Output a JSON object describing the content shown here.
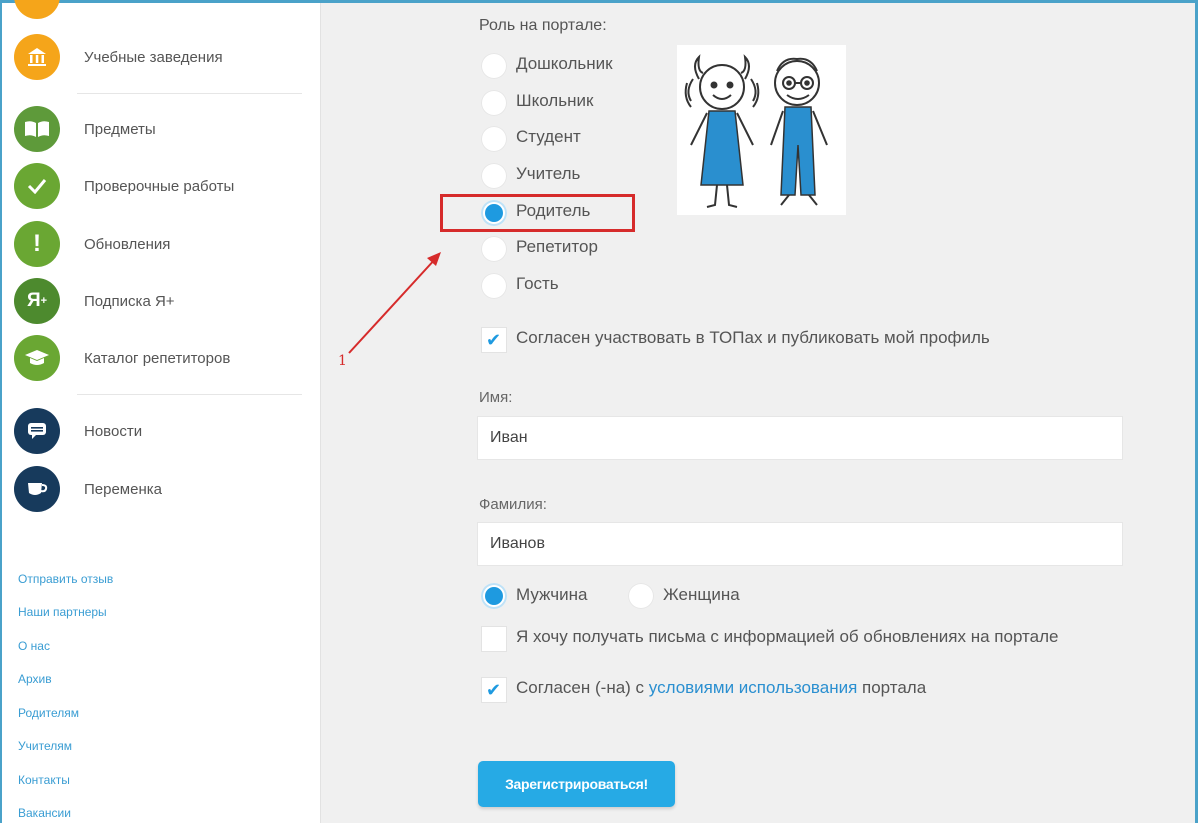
{
  "sidebar": {
    "items": [
      {
        "label": "Учебные заведения",
        "icon": "building-icon",
        "color": "#f5a51a",
        "glyph": "🏛"
      },
      {
        "label": "Предметы",
        "icon": "book-icon",
        "color": "#5e9a3a",
        "glyph": "▮▮"
      },
      {
        "label": "Проверочные работы",
        "icon": "checkmark-icon",
        "color": "#6aa733",
        "glyph": "✓"
      },
      {
        "label": "Обновления",
        "icon": "exclamation-icon",
        "color": "#6aa733",
        "glyph": "!"
      },
      {
        "label": "Подписка Я+",
        "icon": "ya-plus-icon",
        "color": "#4d8a2e",
        "glyph": "Я"
      },
      {
        "label": "Каталог репетиторов",
        "icon": "graduation-cap-icon",
        "color": "#6aa733",
        "glyph": "🎓"
      },
      {
        "label": "Новости",
        "icon": "message-icon",
        "color": "#173a5c",
        "glyph": "▤"
      },
      {
        "label": "Переменка",
        "icon": "cup-icon",
        "color": "#173a5c",
        "glyph": "☕"
      }
    ],
    "footer_links": [
      "Отправить отзыв",
      "Наши партнеры",
      "О нас",
      "Архив",
      "Родителям",
      "Учителям",
      "Контакты",
      "Вакансии"
    ]
  },
  "form": {
    "role_title": "Роль на портале:",
    "roles": [
      {
        "label": "Дошкольник",
        "selected": false
      },
      {
        "label": "Школьник",
        "selected": false
      },
      {
        "label": "Студент",
        "selected": false
      },
      {
        "label": "Учитель",
        "selected": false
      },
      {
        "label": "Родитель",
        "selected": true
      },
      {
        "label": "Репетитор",
        "selected": false
      },
      {
        "label": "Гость",
        "selected": false
      }
    ],
    "annotation_number": "1",
    "top_consent": {
      "label": "Согласен участвовать в ТОПах и публиковать мой профиль",
      "checked": true
    },
    "first_name": {
      "label": "Имя:",
      "value": "Иван"
    },
    "last_name": {
      "label": "Фамилия:",
      "value": "Иванов"
    },
    "gender": [
      {
        "label": "Мужчина",
        "selected": true
      },
      {
        "label": "Женщина",
        "selected": false
      }
    ],
    "newsletter": {
      "label": "Я хочу получать письма с информацией об обновлениях на портале",
      "checked": false
    },
    "terms": {
      "prefix": "Согласен (-на) с ",
      "link": "условиями использования",
      "suffix": " портала",
      "checked": true
    },
    "submit_label": "Зарегистрироваться!"
  },
  "colors": {
    "accent": "#1e9ae0",
    "annotation": "#d62b2b",
    "figure_blue": "#2a8fcf"
  }
}
